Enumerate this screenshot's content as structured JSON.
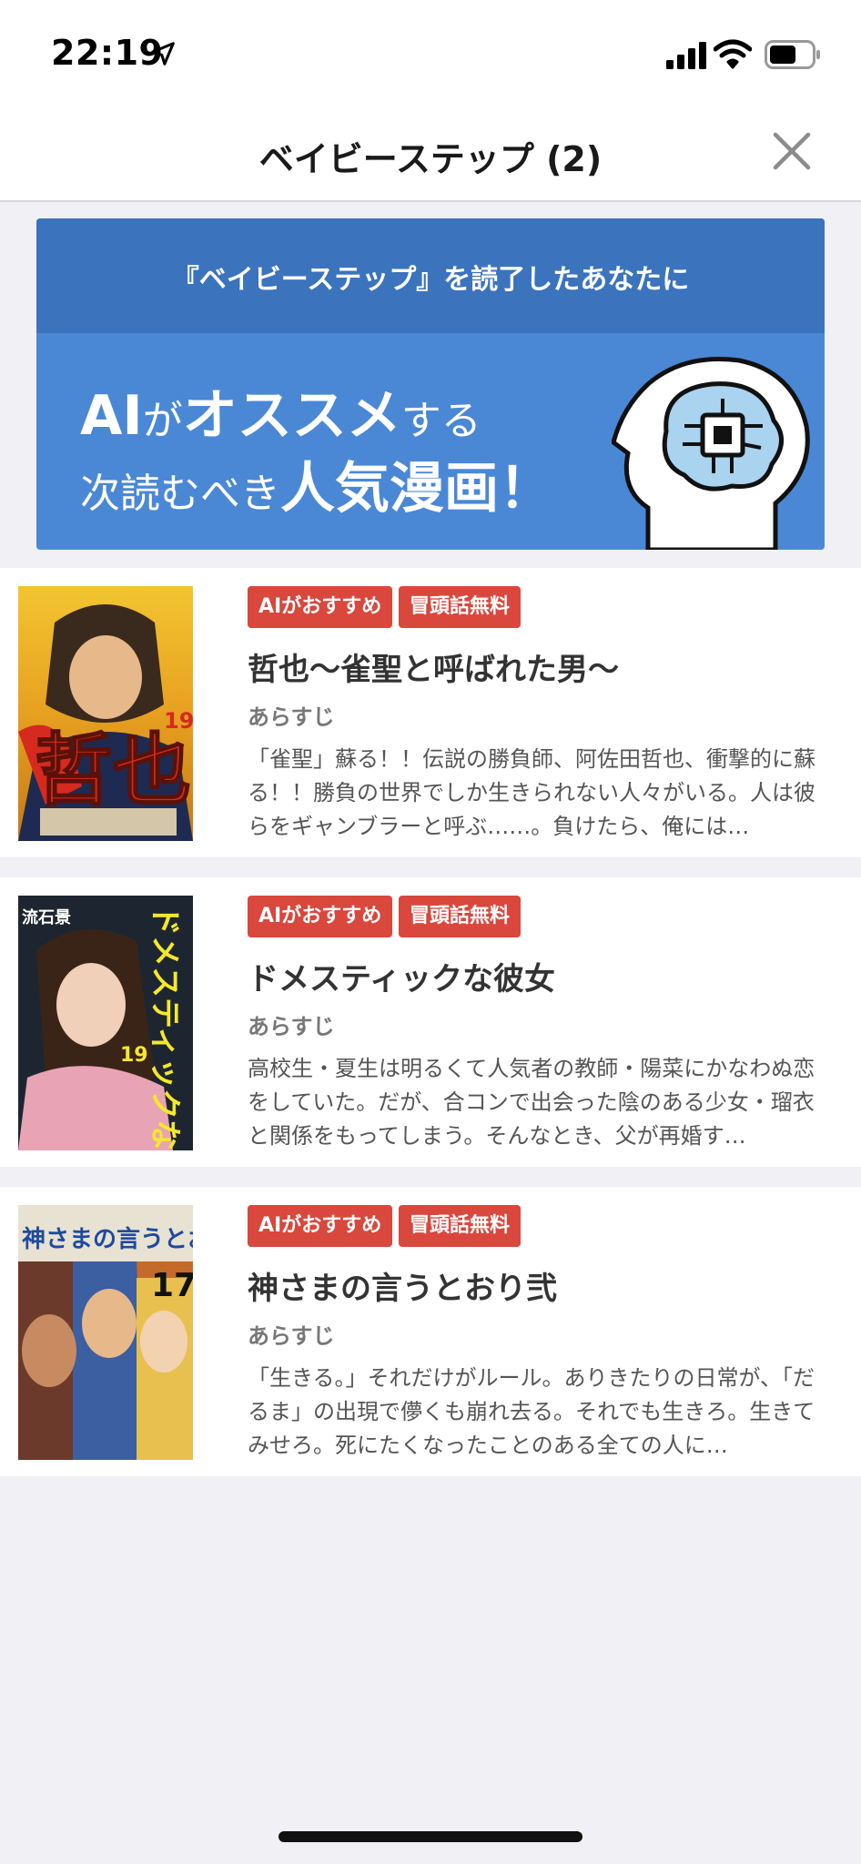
{
  "status_bar": {
    "time": "22:19",
    "icons": [
      "location-arrow-icon",
      "signal-icon",
      "wifi-icon",
      "battery-icon"
    ]
  },
  "header": {
    "title": "ベイビーステップ (2)",
    "close_icon": "close-icon"
  },
  "banner": {
    "top_text": "『ベイビーステップ』を読了したあなたに",
    "line1_a": "AI",
    "line1_b": "が",
    "line1_c": "オススメ",
    "line1_d": "する",
    "line2_a": "次読むべき",
    "line2_b": "人気漫画！",
    "illustration": "ai-brain-head-icon",
    "colors": {
      "top": "#3b73bd",
      "bottom": "#4a88d6"
    }
  },
  "items": [
    {
      "tag_ai": "AIがおすすめ",
      "tag_free": "冒頭話無料",
      "title": "哲也〜雀聖と呼ばれた男〜",
      "synopsis_label": "あらすじ",
      "synopsis": "「雀聖」蘇る！！伝説の勝負師、阿佐田哲也、衝撃的に蘇る！！勝負の世界でしか生きられない人々がいる。人は彼らをギャンブラーと呼ぶ……。負けたら、俺には…",
      "cover_title": "哲也",
      "cover_volume": "19"
    },
    {
      "tag_ai": "AIがおすすめ",
      "tag_free": "冒頭話無料",
      "title": "ドメスティックな彼女",
      "synopsis_label": "あらすじ",
      "synopsis": "高校生・夏生は明るくて人気者の教師・陽菜にかなわぬ恋をしていた。だが、合コンで出会った陰のある少女・瑠衣と関係をもってしまう。そんなとき、父が再婚す…",
      "cover_title": "ドメスティックな彼女",
      "cover_author": "流石景",
      "cover_volume": "19"
    },
    {
      "tag_ai": "AIがおすすめ",
      "tag_free": "冒頭話無料",
      "title": "神さまの言うとおり弐",
      "synopsis_label": "あらすじ",
      "synopsis": "「生きる。」それだけがルール。ありきたりの日常が、「だるま」の出現で儚くも崩れ去る。それでも生きろ。生きてみせろ。死にたくなったことのある全ての人に…",
      "cover_title": "神さまの言うとおり弐",
      "cover_volume": "17"
    }
  ]
}
